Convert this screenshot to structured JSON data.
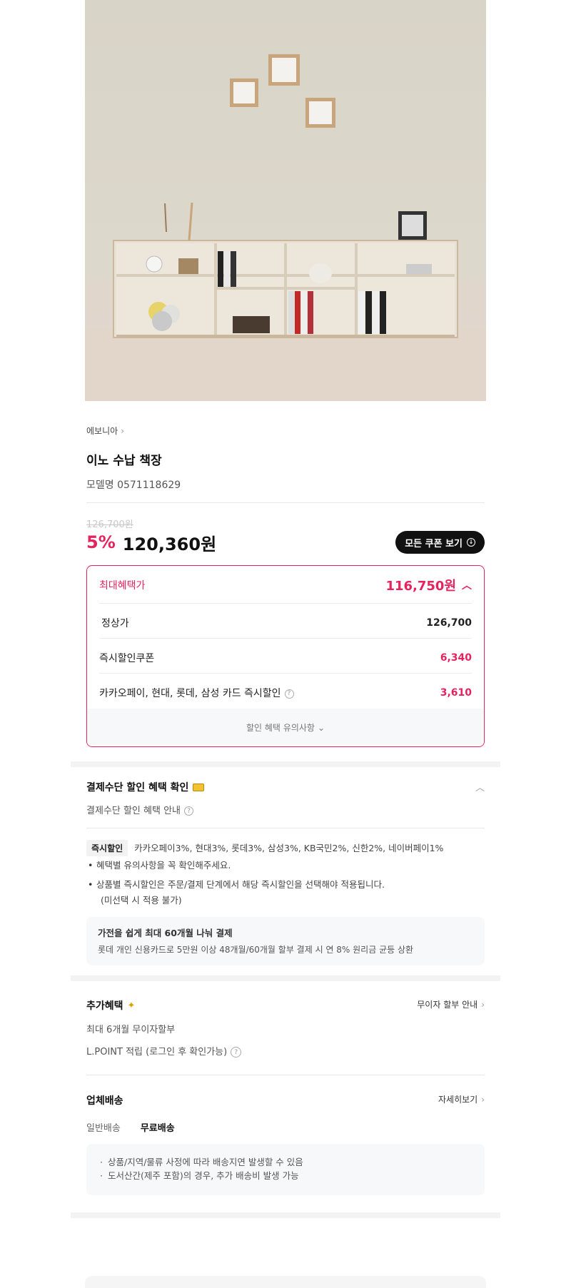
{
  "product_image": {
    "alt_icon": "bookshelf-product-photo"
  },
  "brand": {
    "name": "에보니아"
  },
  "product": {
    "title": "이노 수납 책장",
    "model": "모델명 0571118629"
  },
  "price": {
    "original": "126,700원",
    "discount_rate": "5%",
    "sale": "120,360원",
    "coupon_button": "모든 쿠폰 보기"
  },
  "benefit": {
    "max_label": "최대혜택가",
    "max_value": "116,750원",
    "rows": [
      {
        "label": "정상가",
        "value": "126,700"
      },
      {
        "label": "즉시할인쿠폰",
        "value": "6,340"
      },
      {
        "label": "카카오페이, 현대, 롯데, 삼성 카드 즉시할인",
        "value": "3,610"
      }
    ],
    "footer": "할인 혜택 유의사항"
  },
  "payment": {
    "title": "결제수단 할인 혜택 확인",
    "subtitle": "결제수단 할인 혜택 안내",
    "chip": "즉시할인",
    "cards": "카카오페이3%, 현대3%, 롯데3%, 삼성3%, KB국민2%, 신한2%, 네이버페이1%",
    "notes": [
      "혜택별 유의사항을 꼭 확인해주세요.",
      "상품별 즉시할인은 주문/결제 단계에서 해당 즉시할인을 선택해야 적용됩니다."
    ],
    "note_extra": "(미선택 시 적용 불가)",
    "installment_title": "가전을 쉽게 최대 60개월 나눠 결제",
    "installment_desc": "롯데 개인 신용카드로 5만원 이상 48개월/60개월 할부 결제 시 연 8% 원리금 균등 상환"
  },
  "extra": {
    "title": "추가혜택",
    "link": "무이자 할부 안내",
    "line1": "최대 6개월 무이자할부",
    "line2": "L.POINT 적립 (로그인 후 확인가능)"
  },
  "delivery": {
    "title": "업체배송",
    "link": "자세히보기",
    "tab_general": "일반배송",
    "tab_free": "무료배송",
    "notes": [
      "상품/지역/물류 사정에 따라 배송지연 발생할 수 있음",
      "도서산간(제주 포함)의 경우, 추가 배송비 발생 가능"
    ]
  },
  "colors": {
    "accent": "#e5245e",
    "dark": "#111111",
    "card_bg": "#f7f8fa"
  }
}
